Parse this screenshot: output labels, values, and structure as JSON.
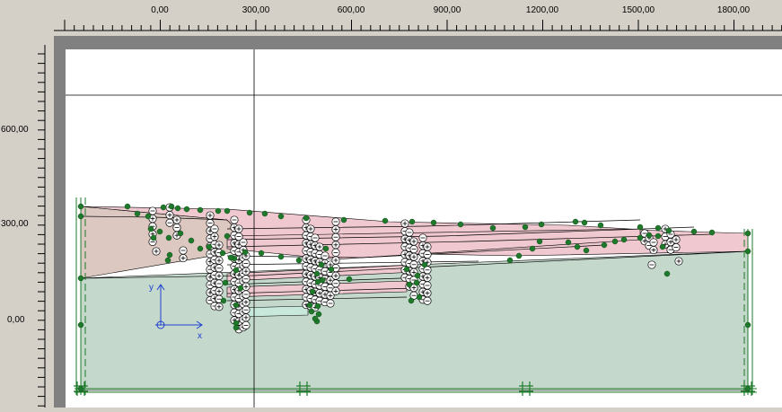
{
  "ruler_top": {
    "labels": [
      "0,00",
      "300,00",
      "600,00",
      "900,00",
      "1200,00",
      "1500,00",
      "1800,00"
    ]
  },
  "ruler_left": {
    "labels": [
      "600,00",
      "300,00",
      "0,00"
    ]
  },
  "axes": {
    "y_label": "y",
    "x_label": "x"
  },
  "colors": {
    "ruler_bg": "#d4d0c8",
    "frame_gray": "#808080",
    "layer_pink": "#f0c8d0",
    "layer_tan": "#dcc8c0",
    "layer_green": "#c4d8cc",
    "node_green": "#1e7a2a",
    "axis_blue": "#1f3fd0"
  }
}
